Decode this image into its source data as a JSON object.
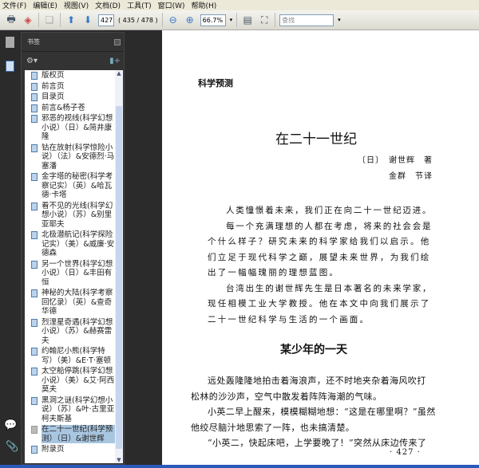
{
  "menu": [
    "文件(F)",
    "编辑(E)",
    "视图(V)",
    "文档(D)",
    "工具(T)",
    "窗口(W)",
    "帮助(H)"
  ],
  "toolbar": {
    "page_value": "427",
    "page_info": "( 435 / 478 )",
    "zoom_value": "66.7%",
    "search_placeholder": "查找"
  },
  "panel": {
    "title": "书签"
  },
  "bookmarks": [
    "版权页",
    "前言页",
    "目录页",
    "前言&杨子苍",
    "邪恶的视线(科学幻想小说）（日）&简井康隆",
    "钴在放射(科学惊险小说）（法）&安德烈·马塞潘",
    "金字塔的秘密(科学考察记实）（英）&哈瓦德·卡塔",
    "看不见的光线(科学幻想小说）（苏）&别里亚耶夫",
    "北极潜航记(科学探险记实）（美）&威廉·安德森",
    "另一个世界(科学幻想小说）（日）&丰田有恒",
    "神秘的大陆(科学考察回忆录）（英）&查奇华德",
    "烈浬星奇遇(科学幻想小说）（苏）&赫赛雷夫",
    "约翰尼小熊(科学特写）（美）&E·T·塞顿",
    "太空船停跳(科学幻想小说）（美）&艾·阿西莫夫",
    "黑洞之谜(科学幻想小说）（苏）&叶·古里亚柯夫斯基",
    "在二十一世纪(科学预测）（日）&谢世辉",
    "附录页"
  ],
  "selected_bookmark": 15,
  "document": {
    "header": "科学预测",
    "title": "在二十一世纪",
    "author": "〔日〕　谢世辉　著",
    "translator": "金群　节译",
    "intro": [
      "人类憧憬着未来，我们正在向二十一世纪迈进。",
      "每一个充满理想的人都在考虑，将来的社会会是",
      "个什么样子？研究未来的科学家给我们以启示。他",
      "们立足于现代科学之巅，展望未来世界，为我们绘",
      "出了一幅幅瑰丽的理想蓝图。",
      "台湾出生的谢世辉先生是日本著名的未来学家，",
      "现任相模工业大学教授。他在本文中向我们展示了",
      "二十一世纪科学与生活的一个画面。"
    ],
    "section": "某少年的一天",
    "body": [
      "远处轰隆隆地拍击着海浪声，还不时地夹杂着海风吹打",
      "松林的沙沙声，空气中散发着阵阵海潮的气味。",
      "小英二早上醒来，模模糊糊地想：“这是在哪里啊？”虽然",
      "他绞尽脑汁地思索了一阵，也未搞清楚。",
      "“小英二，快起床吧，上学要晚了！”突然从床边传来了"
    ],
    "page_number": "· 427 ·"
  }
}
